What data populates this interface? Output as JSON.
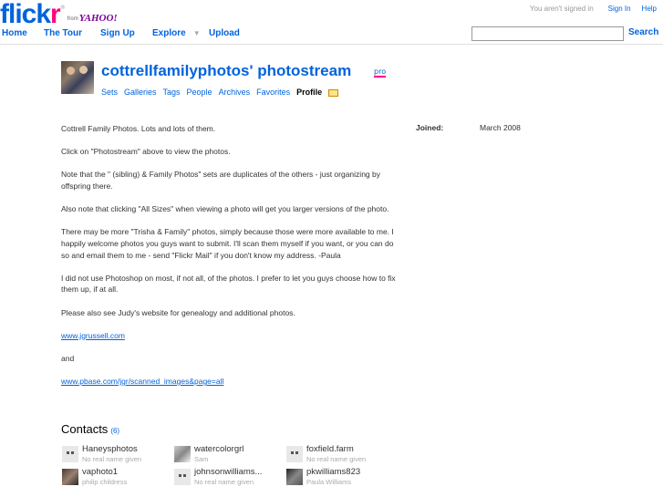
{
  "header": {
    "logo_blue": "flick",
    "logo_pink": "r",
    "logo_reg": "®",
    "logo_from": "from",
    "logo_yahoo": "YAHOO!",
    "signin_message": "You aren't signed in",
    "signin_link": "Sign In",
    "help_link": "Help"
  },
  "nav": {
    "home": "Home",
    "tour": "The Tour",
    "signup": "Sign Up",
    "explore": "Explore",
    "upload": "Upload",
    "search_value": "",
    "search_button": "Search"
  },
  "profile": {
    "title": "cottrellfamilyphotos' photostream",
    "pro_badge": "pro",
    "subnav": [
      "Sets",
      "Galleries",
      "Tags",
      "People",
      "Archives",
      "Favorites",
      "Profile"
    ],
    "active_tab": "Profile",
    "joined_label": "Joined:",
    "joined_value": "March 2008"
  },
  "description": [
    "Cottrell Family Photos. Lots and lots of them.",
    "Click on \"Photostream\" above to view the photos.",
    "Note that the \" (sibling) & Family Photos\" sets are duplicates of the others - just organizing by offspring there.",
    "Also note that clicking \"All Sizes\" when viewing a photo will get you larger versions of the photo.",
    "There may be more \"Trisha & Family\" photos, simply because those were more available to me. I happily welcome photos you guys want to submit. I'll scan them myself if you want, or you can do so and email them to me - send \"Flickr Mail\" if you don't know my address. -Paula",
    "I did not use Photoshop on most, if not all, of the photos. I prefer to let you guys choose how to fix them up, if at all.",
    "Please also see Judy's website for genealogy and additional photos."
  ],
  "links": {
    "link1": "www.jgrussell.com",
    "and": "and",
    "link2": "www.pbase.com/jgr/scanned_images&page=all"
  },
  "contacts": {
    "heading": "Contacts",
    "count": "(6)",
    "items": [
      {
        "name": "Haneysphotos",
        "realname": "No real name given",
        "avatar": "default"
      },
      {
        "name": "watercolorgrl",
        "realname": "Sam",
        "avatar": "photo2"
      },
      {
        "name": "foxfield.farm",
        "realname": "No real name given",
        "avatar": "default"
      },
      {
        "name": "vaphoto1",
        "realname": "philip childress",
        "avatar": "photo1"
      },
      {
        "name": "johnsonwilliams...",
        "realname": "No real name given",
        "avatar": "default"
      },
      {
        "name": "pkwilliams823",
        "realname": "Paula Williams",
        "avatar": "photo3"
      }
    ]
  }
}
